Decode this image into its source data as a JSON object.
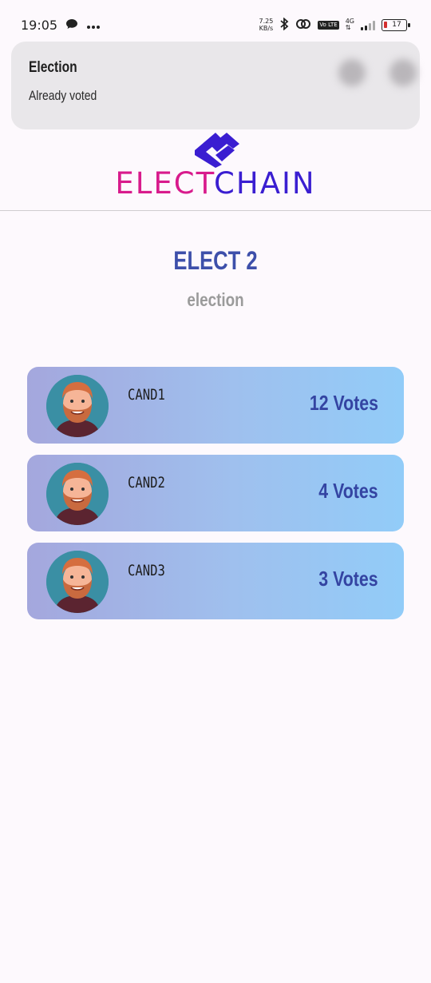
{
  "status_bar": {
    "time": "19:05",
    "speed_value": "7.25",
    "speed_unit": "KB/s",
    "network": "4G",
    "volte": "Vo LTE",
    "battery": "17",
    "icons": [
      "chat-bubble-icon",
      "more-dots-icon",
      "bluetooth-icon",
      "link-icon",
      "volte-icon",
      "signal-icon",
      "battery-icon"
    ]
  },
  "notification": {
    "title": "Election",
    "body": "Already voted"
  },
  "brand": {
    "part1": "ELECT",
    "part2": "CHAIN",
    "color_elect": "#d81b8c",
    "color_chain": "#3a1ed1"
  },
  "election": {
    "title": "ELECT 2",
    "subtitle": "election"
  },
  "candidates": [
    {
      "name": "CAND1",
      "votes": "12 Votes"
    },
    {
      "name": "CAND2",
      "votes": "4 Votes"
    },
    {
      "name": "CAND3",
      "votes": "3 Votes"
    }
  ],
  "colors": {
    "title": "#3d4faa",
    "votes": "#3444a2",
    "card_gradient_start": "#a4a7dd",
    "card_gradient_end": "#92ccf8"
  }
}
